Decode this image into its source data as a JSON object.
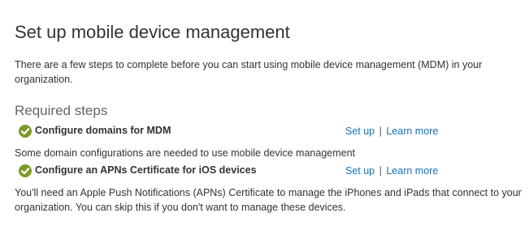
{
  "page": {
    "title": "Set up mobile device management",
    "intro": "There are a few steps to complete before you can start using mobile device management (MDM) in your organization."
  },
  "required_steps": {
    "heading": "Required steps",
    "steps": [
      {
        "icon": "check-circle-icon",
        "title": "Configure domains for MDM",
        "setup_label": "Set up",
        "separator": "|",
        "learn_more_label": "Learn more",
        "description": "Some domain configurations are needed to use mobile device management"
      },
      {
        "icon": "check-circle-icon",
        "title": "Configure an APNs Certificate for iOS devices",
        "setup_label": "Set up",
        "separator": "|",
        "learn_more_label": "Learn more",
        "description": "You'll need an Apple Push Notifications (APNs) Certificate to manage the iPhones and iPads that connect to your organization. You can skip this if you don't want to manage these devices."
      }
    ]
  },
  "colors": {
    "text": "#333333",
    "heading_secondary": "#666666",
    "link": "#1a6fb4",
    "check_green": "#7a9b26"
  }
}
